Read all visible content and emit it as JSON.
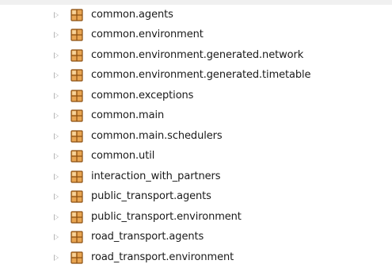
{
  "package_explorer": {
    "items": [
      {
        "label": "common.agents",
        "icon": "package-icon"
      },
      {
        "label": "common.environment",
        "icon": "package-icon"
      },
      {
        "label": "common.environment.generated.network",
        "icon": "package-icon"
      },
      {
        "label": "common.environment.generated.timetable",
        "icon": "package-icon"
      },
      {
        "label": "common.exceptions",
        "icon": "package-icon"
      },
      {
        "label": "common.main",
        "icon": "package-icon"
      },
      {
        "label": "common.main.schedulers",
        "icon": "package-icon"
      },
      {
        "label": "common.util",
        "icon": "package-icon"
      },
      {
        "label": "interaction_with_partners",
        "icon": "package-icon"
      },
      {
        "label": "public_transport.agents",
        "icon": "package-icon"
      },
      {
        "label": "public_transport.environment",
        "icon": "package-icon"
      },
      {
        "label": "road_transport.agents",
        "icon": "package-icon"
      },
      {
        "label": "road_transport.environment",
        "icon": "package-icon"
      }
    ]
  },
  "colors": {
    "package_icon_fill": "#e8a552",
    "package_icon_stroke": "#8a4f12",
    "expander": "#b5b5b5",
    "text": "#1a1a1a",
    "background": "#ffffff"
  }
}
